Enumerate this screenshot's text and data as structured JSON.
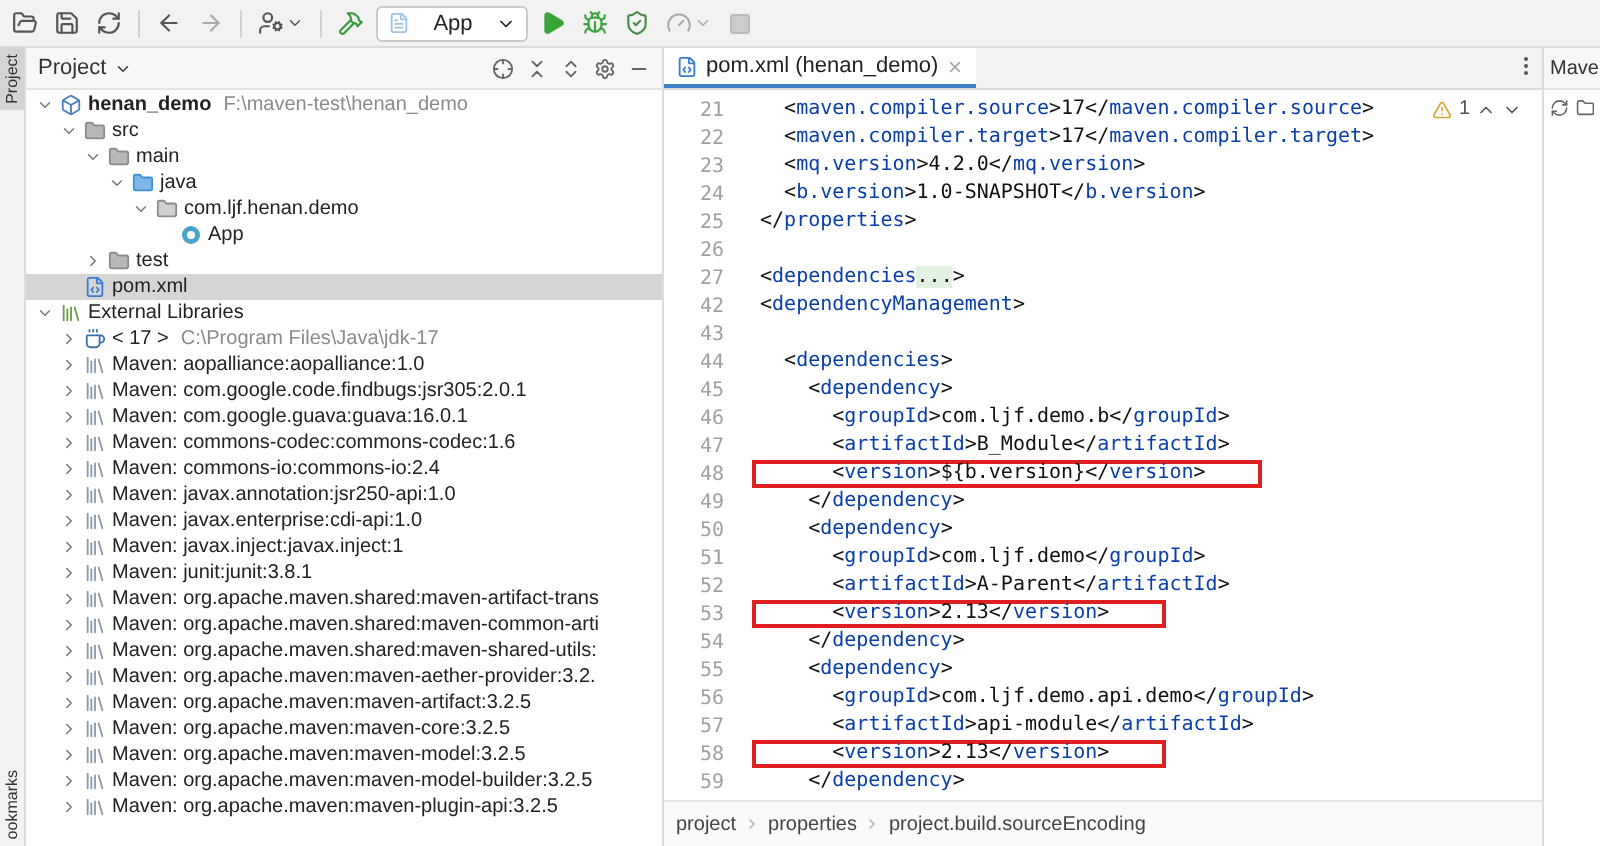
{
  "toolbar": {
    "run_configuration": "App"
  },
  "tool_stripe": {
    "tabs": [
      {
        "label": "Project",
        "selected": true
      },
      {
        "label": "ookmarks",
        "selected": false
      }
    ]
  },
  "project_panel": {
    "title": "Project",
    "tree": [
      {
        "label": "henan_demo",
        "kind": "module",
        "path": "F:\\maven-test\\henan_demo",
        "expanded": true,
        "selected": false,
        "children": [
          {
            "label": "src",
            "kind": "folder",
            "expanded": true,
            "selected": false,
            "children": [
              {
                "label": "main",
                "kind": "folder",
                "expanded": true,
                "selected": false,
                "children": [
                  {
                    "label": "java",
                    "kind": "source",
                    "expanded": true,
                    "selected": false,
                    "children": [
                      {
                        "label": "com.ljf.henan.demo",
                        "kind": "package",
                        "expanded": true,
                        "selected": false,
                        "children": [
                          {
                            "label": "App",
                            "kind": "class",
                            "selected": false
                          }
                        ]
                      }
                    ]
                  }
                ]
              },
              {
                "label": "test",
                "kind": "folder",
                "expanded": false,
                "selected": false
              }
            ]
          },
          {
            "label": "pom.xml",
            "kind": "pom",
            "selected": true
          }
        ]
      },
      {
        "label": "External Libraries",
        "kind": "libraries",
        "expanded": true,
        "selected": false,
        "children": [
          {
            "label": "< 17 >",
            "kind": "jdk",
            "path": "C:\\Program Files\\Java\\jdk-17",
            "expanded": false,
            "selected": false
          },
          {
            "label": "Maven: aopalliance:aopalliance:1.0",
            "kind": "library",
            "expanded": false,
            "selected": false
          },
          {
            "label": "Maven: com.google.code.findbugs:jsr305:2.0.1",
            "kind": "library",
            "expanded": false,
            "selected": false
          },
          {
            "label": "Maven: com.google.guava:guava:16.0.1",
            "kind": "library",
            "expanded": false,
            "selected": false
          },
          {
            "label": "Maven: commons-codec:commons-codec:1.6",
            "kind": "library",
            "expanded": false,
            "selected": false
          },
          {
            "label": "Maven: commons-io:commons-io:2.4",
            "kind": "library",
            "expanded": false,
            "selected": false
          },
          {
            "label": "Maven: javax.annotation:jsr250-api:1.0",
            "kind": "library",
            "expanded": false,
            "selected": false
          },
          {
            "label": "Maven: javax.enterprise:cdi-api:1.0",
            "kind": "library",
            "expanded": false,
            "selected": false
          },
          {
            "label": "Maven: javax.inject:javax.inject:1",
            "kind": "library",
            "expanded": false,
            "selected": false
          },
          {
            "label": "Maven: junit:junit:3.8.1",
            "kind": "library",
            "expanded": false,
            "selected": false
          },
          {
            "label": "Maven: org.apache.maven.shared:maven-artifact-trans",
            "kind": "library",
            "expanded": false,
            "selected": false
          },
          {
            "label": "Maven: org.apache.maven.shared:maven-common-arti",
            "kind": "library",
            "expanded": false,
            "selected": false
          },
          {
            "label": "Maven: org.apache.maven.shared:maven-shared-utils:",
            "kind": "library",
            "expanded": false,
            "selected": false
          },
          {
            "label": "Maven: org.apache.maven:maven-aether-provider:3.2.",
            "kind": "library",
            "expanded": false,
            "selected": false
          },
          {
            "label": "Maven: org.apache.maven:maven-artifact:3.2.5",
            "kind": "library",
            "expanded": false,
            "selected": false
          },
          {
            "label": "Maven: org.apache.maven:maven-core:3.2.5",
            "kind": "library",
            "expanded": false,
            "selected": false
          },
          {
            "label": "Maven: org.apache.maven:maven-model:3.2.5",
            "kind": "library",
            "expanded": false,
            "selected": false
          },
          {
            "label": "Maven: org.apache.maven:maven-model-builder:3.2.5",
            "kind": "library",
            "expanded": false,
            "selected": false
          },
          {
            "label": "Maven: org.apache.maven:maven-plugin-api:3.2.5",
            "kind": "library",
            "expanded": false,
            "selected": false
          }
        ]
      }
    ]
  },
  "editor": {
    "tabs": [
      {
        "label": "pom.xml (henan_demo)",
        "selected": true
      }
    ],
    "inspection": {
      "warnings": "1"
    },
    "lines": [
      {
        "number": "21",
        "highlighted": false,
        "segments": [
          {
            "kind": "text",
            "text": "  <"
          },
          {
            "kind": "tag",
            "text": "maven.compiler.source"
          },
          {
            "kind": "text",
            "text": ">17</"
          },
          {
            "kind": "tag",
            "text": "maven.compiler.source"
          },
          {
            "kind": "text",
            "text": ">"
          }
        ]
      },
      {
        "number": "22",
        "highlighted": false,
        "segments": [
          {
            "kind": "text",
            "text": "  <"
          },
          {
            "kind": "tag",
            "text": "maven.compiler.target"
          },
          {
            "kind": "text",
            "text": ">17</"
          },
          {
            "kind": "tag",
            "text": "maven.compiler.target"
          },
          {
            "kind": "text",
            "text": ">"
          }
        ]
      },
      {
        "number": "23",
        "highlighted": false,
        "segments": [
          {
            "kind": "text",
            "text": "  <"
          },
          {
            "kind": "tag",
            "text": "mq.version"
          },
          {
            "kind": "text",
            "text": ">4.2.0</"
          },
          {
            "kind": "tag",
            "text": "mq.version"
          },
          {
            "kind": "text",
            "text": ">"
          }
        ]
      },
      {
        "number": "24",
        "highlighted": false,
        "segments": [
          {
            "kind": "text",
            "text": "  <"
          },
          {
            "kind": "tag",
            "text": "b.version"
          },
          {
            "kind": "text",
            "text": ">1.0-SNAPSHOT</"
          },
          {
            "kind": "tag",
            "text": "b.version"
          },
          {
            "kind": "text",
            "text": ">"
          }
        ]
      },
      {
        "number": "25",
        "highlighted": false,
        "segments": [
          {
            "kind": "text",
            "text": "</"
          },
          {
            "kind": "tag",
            "text": "properties"
          },
          {
            "kind": "text",
            "text": ">"
          }
        ]
      },
      {
        "number": "26"
      },
      {
        "number": "27",
        "highlighted": false,
        "segments": [
          {
            "kind": "text",
            "text": "<"
          },
          {
            "kind": "tag",
            "text": "dependencies"
          },
          {
            "kind": "fold",
            "text": "..."
          },
          {
            "kind": "text",
            "text": ">"
          }
        ]
      },
      {
        "number": "42",
        "highlighted": false,
        "segments": [
          {
            "kind": "text",
            "text": "<"
          },
          {
            "kind": "tag",
            "text": "dependencyManagement"
          },
          {
            "kind": "text",
            "text": ">"
          }
        ]
      },
      {
        "number": "43"
      },
      {
        "number": "44",
        "highlighted": false,
        "segments": [
          {
            "kind": "text",
            "text": "  <"
          },
          {
            "kind": "tag",
            "text": "dependencies"
          },
          {
            "kind": "text",
            "text": ">"
          }
        ]
      },
      {
        "number": "45",
        "highlighted": false,
        "segments": [
          {
            "kind": "text",
            "text": "    <"
          },
          {
            "kind": "tag",
            "text": "dependency"
          },
          {
            "kind": "text",
            "text": ">"
          }
        ]
      },
      {
        "number": "46",
        "highlighted": false,
        "segments": [
          {
            "kind": "text",
            "text": "      <"
          },
          {
            "kind": "tag",
            "text": "groupId"
          },
          {
            "kind": "text",
            "text": ">com.ljf.demo.b</"
          },
          {
            "kind": "tag",
            "text": "groupId"
          },
          {
            "kind": "text",
            "text": ">"
          }
        ]
      },
      {
        "number": "47",
        "highlighted": false,
        "segments": [
          {
            "kind": "text",
            "text": "      <"
          },
          {
            "kind": "tag",
            "text": "artifactId"
          },
          {
            "kind": "text",
            "text": ">B_Module</"
          },
          {
            "kind": "tag",
            "text": "artifactId"
          },
          {
            "kind": "text",
            "text": ">"
          }
        ]
      },
      {
        "number": "48",
        "highlighted": true,
        "segments": [
          {
            "kind": "text",
            "text": "      <"
          },
          {
            "kind": "tag",
            "text": "version"
          },
          {
            "kind": "text",
            "text": ">${b.version}</"
          },
          {
            "kind": "tag",
            "text": "version"
          },
          {
            "kind": "text",
            "text": ">"
          }
        ]
      },
      {
        "number": "49",
        "highlighted": false,
        "segments": [
          {
            "kind": "text",
            "text": "    </"
          },
          {
            "kind": "tag",
            "text": "dependency"
          },
          {
            "kind": "text",
            "text": ">"
          }
        ]
      },
      {
        "number": "50",
        "highlighted": false,
        "segments": [
          {
            "kind": "text",
            "text": "    <"
          },
          {
            "kind": "tag",
            "text": "dependency"
          },
          {
            "kind": "text",
            "text": ">"
          }
        ]
      },
      {
        "number": "51",
        "highlighted": false,
        "segments": [
          {
            "kind": "text",
            "text": "      <"
          },
          {
            "kind": "tag",
            "text": "groupId"
          },
          {
            "kind": "text",
            "text": ">com.ljf.demo</"
          },
          {
            "kind": "tag",
            "text": "groupId"
          },
          {
            "kind": "text",
            "text": ">"
          }
        ]
      },
      {
        "number": "52",
        "highlighted": false,
        "segments": [
          {
            "kind": "text",
            "text": "      <"
          },
          {
            "kind": "tag",
            "text": "artifactId"
          },
          {
            "kind": "text",
            "text": ">A-Parent</"
          },
          {
            "kind": "tag",
            "text": "artifactId"
          },
          {
            "kind": "text",
            "text": ">"
          }
        ]
      },
      {
        "number": "53",
        "highlighted": true,
        "segments": [
          {
            "kind": "text",
            "text": "      <"
          },
          {
            "kind": "tag",
            "text": "version"
          },
          {
            "kind": "text",
            "text": ">2.13</"
          },
          {
            "kind": "tag",
            "text": "version"
          },
          {
            "kind": "text",
            "text": ">"
          }
        ]
      },
      {
        "number": "54",
        "highlighted": false,
        "segments": [
          {
            "kind": "text",
            "text": "    </"
          },
          {
            "kind": "tag",
            "text": "dependency"
          },
          {
            "kind": "text",
            "text": ">"
          }
        ]
      },
      {
        "number": "55",
        "highlighted": false,
        "segments": [
          {
            "kind": "text",
            "text": "    <"
          },
          {
            "kind": "tag",
            "text": "dependency"
          },
          {
            "kind": "text",
            "text": ">"
          }
        ]
      },
      {
        "number": "56",
        "highlighted": false,
        "segments": [
          {
            "kind": "text",
            "text": "      <"
          },
          {
            "kind": "tag",
            "text": "groupId"
          },
          {
            "kind": "text",
            "text": ">com.ljf.demo.api.demo</"
          },
          {
            "kind": "tag",
            "text": "groupId"
          },
          {
            "kind": "text",
            "text": ">"
          }
        ]
      },
      {
        "number": "57",
        "highlighted": false,
        "segments": [
          {
            "kind": "text",
            "text": "      <"
          },
          {
            "kind": "tag",
            "text": "artifactId"
          },
          {
            "kind": "text",
            "text": ">api-module</"
          },
          {
            "kind": "tag",
            "text": "artifactId"
          },
          {
            "kind": "text",
            "text": ">"
          }
        ]
      },
      {
        "number": "58",
        "highlighted": true,
        "segments": [
          {
            "kind": "text",
            "text": "      <"
          },
          {
            "kind": "tag",
            "text": "version"
          },
          {
            "kind": "text",
            "text": ">2.13</"
          },
          {
            "kind": "tag",
            "text": "version"
          },
          {
            "kind": "text",
            "text": ">"
          }
        ]
      },
      {
        "number": "59",
        "highlighted": false,
        "segments": [
          {
            "kind": "text",
            "text": "    </"
          },
          {
            "kind": "tag",
            "text": "dependency"
          },
          {
            "kind": "text",
            "text": ">"
          }
        ]
      }
    ],
    "breadcrumbs": [
      "project",
      "properties",
      "project.build.sourceEncoding"
    ]
  },
  "maven_panel": {
    "title": "Mave"
  }
}
